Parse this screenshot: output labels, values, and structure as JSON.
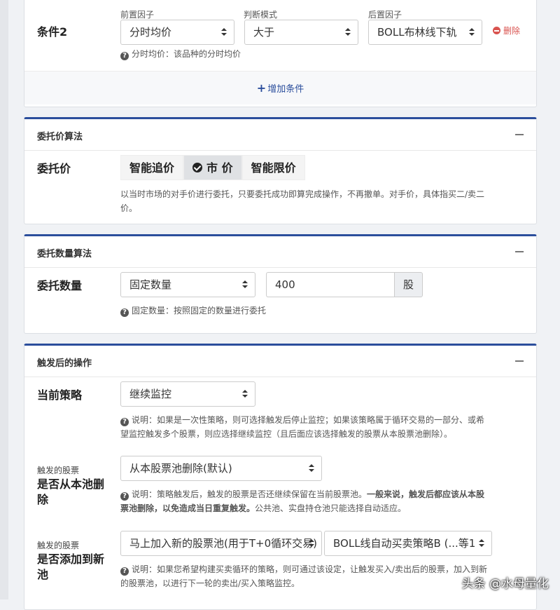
{
  "condition2": {
    "label": "条件2",
    "pre_factor_caption": "前置因子",
    "judge_caption": "判断模式",
    "post_factor_caption": "后置因子",
    "pre_factor_value": "分时均价",
    "judge_value": "大于",
    "post_factor_value": "BOLL布林线下轨",
    "delete_label": "删除",
    "help": "分时均价：该品种的分时均价",
    "add_condition_label": "增加条件"
  },
  "order_price": {
    "section_title": "委托价算法",
    "label": "委托价",
    "options": [
      "智能追价",
      "市 价",
      "智能限价"
    ],
    "selected": "市 价",
    "help_line1": "以当时市场的对手价进行委托，只要委托成功即算完成操作，不再撤单。对手价，具体指买二/卖二",
    "help_line2": "价。"
  },
  "order_qty": {
    "section_title": "委托数量算法",
    "label": "委托数量",
    "mode_value": "固定数量",
    "qty_value": "400",
    "unit": "股",
    "help": "固定数量：按照固定的数量进行委托"
  },
  "after_trigger": {
    "section_title": "触发后的操作",
    "current_strategy_label": "当前策略",
    "current_strategy_value": "继续监控",
    "current_strategy_help_1": "说明：如果是一次性策略，则可选择触发后停止监控；如果该策略属于循环交易的一部分、或希",
    "current_strategy_help_2": "望监控触发多个股票，则应选择继续监控（且后面应该选择触发的股票从本股票池删除）。",
    "remove_sub": "触发的股票",
    "remove_label_1": "是否从本池删",
    "remove_label_2": "除",
    "remove_value": "从本股票池删除(默认)",
    "remove_help_1a": "说明：策略触发后，触发的股票是否还继续保留在当前股票池。",
    "remove_help_1b": "一般来说，触发后都应该从本股",
    "remove_help_2a": "票池删除，以免造成当日重复触发。",
    "remove_help_2b": "公共池、实盘持仓池只能选择自动适应。",
    "add_sub": "触发的股票",
    "add_label_1": "是否添加到新",
    "add_label_2": "池",
    "add_pool_value": "马上加入新的股票池(用于T+0循环交易)",
    "add_strategy_value": "BOLL线自动买卖策略B (...等1",
    "add_help_1": "说明：如果您希望构建买卖循环的策略，则可通过该设定，让触发买入/卖出后的股票，加入到新",
    "add_help_2": "的股票池，以进行下一轮的卖出/买入策略监控。"
  },
  "watermark": "头条 @水母量化",
  "colors": {
    "accent": "#2b4e9c",
    "danger": "#d9534f"
  }
}
